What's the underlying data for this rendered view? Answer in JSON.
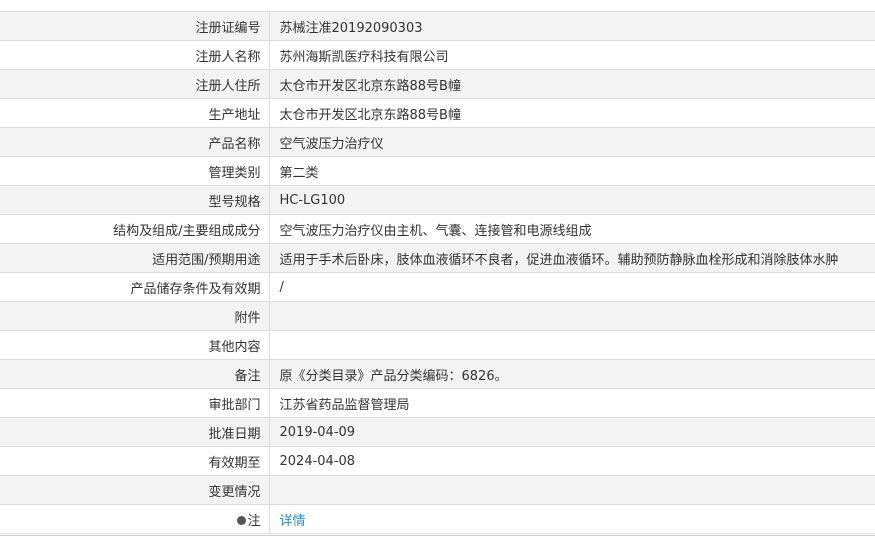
{
  "rows": [
    {
      "label": "注册证编号",
      "value": "苏械注准20192090303"
    },
    {
      "label": "注册人名称",
      "value": "苏州海斯凯医疗科技有限公司"
    },
    {
      "label": "注册人住所",
      "value": "太仓市开发区北京东路88号B幢"
    },
    {
      "label": "生产地址",
      "value": "太仓市开发区北京东路88号B幢"
    },
    {
      "label": "产品名称",
      "value": "空气波压力治疗仪"
    },
    {
      "label": "管理类别",
      "value": "第二类"
    },
    {
      "label": "型号规格",
      "value": "HC-LG100"
    },
    {
      "label": "结构及组成/主要组成成分",
      "value": "空气波压力治疗仪由主机、气囊、连接管和电源线组成"
    },
    {
      "label": "适用范围/预期用途",
      "value": "适用于手术后卧床，肢体血液循环不良者，促进血液循环。辅助预防静脉血栓形成和消除肢体水肿"
    },
    {
      "label": "产品储存条件及有效期",
      "value": "/"
    },
    {
      "label": "附件",
      "value": ""
    },
    {
      "label": "其他内容",
      "value": ""
    },
    {
      "label": "备注",
      "value": "原《分类目录》产品分类编码：6826。"
    },
    {
      "label": "审批部门",
      "value": "江苏省药品监督管理局"
    },
    {
      "label": "批准日期",
      "value": "2019-04-09"
    },
    {
      "label": "有效期至",
      "value": "2024-04-08"
    },
    {
      "label": "变更情况",
      "value": ""
    }
  ],
  "note": {
    "label": "注",
    "icon": "pin-icon",
    "link": "详情"
  },
  "colors": {
    "stripe": "#f3f3f3",
    "border": "#dcdcdc",
    "link": "#2f8bcf"
  }
}
